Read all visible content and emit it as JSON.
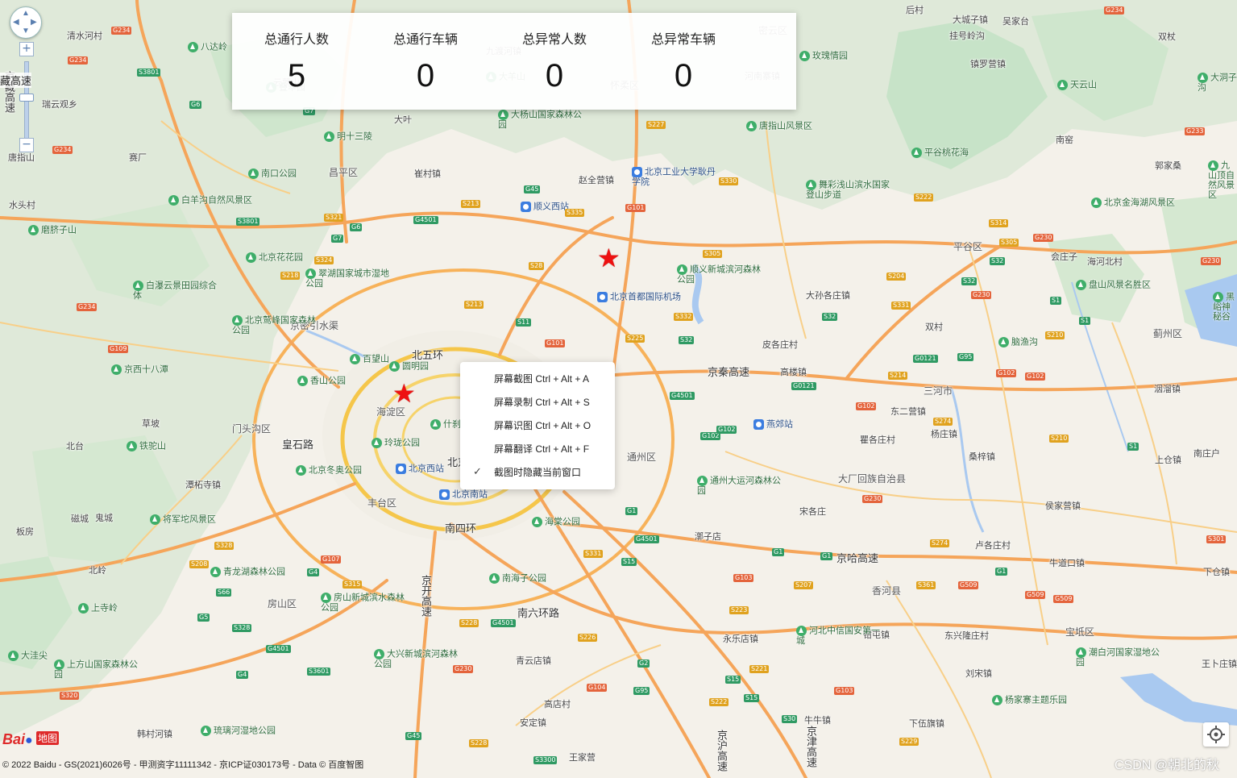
{
  "stats": [
    {
      "title": "总通行人数",
      "value": "5"
    },
    {
      "title": "总通行车辆",
      "value": "0"
    },
    {
      "title": "总异常人数",
      "value": "0"
    },
    {
      "title": "总异常车辆",
      "value": "0"
    }
  ],
  "context_menu": [
    {
      "label": "屏幕截图 Ctrl + Alt + A",
      "checked": false
    },
    {
      "label": "屏幕录制 Ctrl + Alt + S",
      "checked": false
    },
    {
      "label": "屏幕识图 Ctrl + Alt + O",
      "checked": false
    },
    {
      "label": "屏幕翻译 Ctrl + Alt + F",
      "checked": false
    },
    {
      "label": "截图时隐藏当前窗口",
      "checked": true
    }
  ],
  "nav": {
    "zoom_in": "+",
    "zoom_out": "−",
    "side_label": "藏高速"
  },
  "footer": {
    "copyright": "© 2022 Baidu - GS(2021)6026号 - 甲测资字11111342 - 京ICP证030173号 - Data © 百度智图",
    "logo_text": "Bai",
    "logo_map": "地图",
    "watermark": "CSDN @朝北的秋"
  },
  "map_labels": [
    {
      "t": "北五环",
      "c": "road"
    },
    {
      "t": "南四环",
      "c": "road"
    },
    {
      "t": "南六环路",
      "c": "road"
    },
    {
      "t": "京秦高速",
      "c": "road"
    },
    {
      "t": "京哈高速",
      "c": "road"
    },
    {
      "t": "皇石路",
      "c": "road"
    },
    {
      "t": "京开高速",
      "c": "road vert"
    },
    {
      "t": "京沪高速",
      "c": "road vert"
    },
    {
      "t": "京津高速",
      "c": "road vert"
    },
    {
      "t": "京藏高速",
      "c": "road vert"
    },
    {
      "t": "京密引水渠",
      "c": "dist"
    },
    {
      "t": "北京市",
      "c": "big"
    },
    {
      "t": "海淀区",
      "c": "dist"
    },
    {
      "t": "昌平区",
      "c": "dist"
    },
    {
      "t": "门头沟区",
      "c": "dist"
    },
    {
      "t": "丰台区",
      "c": "dist"
    },
    {
      "t": "房山区",
      "c": "dist"
    },
    {
      "t": "通州区",
      "c": "dist"
    },
    {
      "t": "平谷区",
      "c": "dist"
    },
    {
      "t": "三河市",
      "c": "dist"
    },
    {
      "t": "大厂回族自治县",
      "c": "dist"
    },
    {
      "t": "香河县",
      "c": "dist"
    },
    {
      "t": "宝坻区",
      "c": "dist"
    },
    {
      "t": "蓟州区",
      "c": "dist"
    },
    {
      "t": "怀柔区",
      "c": "dist"
    },
    {
      "t": "密云区",
      "c": "dist"
    },
    {
      "t": "清水河村",
      "c": ""
    },
    {
      "t": "瑞云观乡",
      "c": ""
    },
    {
      "t": "唐指山",
      "c": ""
    },
    {
      "t": "赛厂",
      "c": ""
    },
    {
      "t": "崔村镇",
      "c": ""
    },
    {
      "t": "赵全营镇",
      "c": ""
    },
    {
      "t": "南窑",
      "c": ""
    },
    {
      "t": "大孙各庄镇",
      "c": ""
    },
    {
      "t": "皮各庄村",
      "c": ""
    },
    {
      "t": "高楼镇",
      "c": ""
    },
    {
      "t": "双村",
      "c": ""
    },
    {
      "t": "东二营镇",
      "c": ""
    },
    {
      "t": "杨庄镇",
      "c": ""
    },
    {
      "t": "桑梓镇",
      "c": ""
    },
    {
      "t": "侯家营镇",
      "c": ""
    },
    {
      "t": "上仓镇",
      "c": ""
    },
    {
      "t": "南庄户",
      "c": ""
    },
    {
      "t": "洇溜镇",
      "c": ""
    },
    {
      "t": "瞿各庄村",
      "c": ""
    },
    {
      "t": "宋各庄",
      "c": ""
    },
    {
      "t": "漷子店",
      "c": ""
    },
    {
      "t": "永乐店镇",
      "c": ""
    },
    {
      "t": "牛道口镇",
      "c": ""
    },
    {
      "t": "卢各庄村",
      "c": ""
    },
    {
      "t": "钳屯镇",
      "c": ""
    },
    {
      "t": "东兴隆庄村",
      "c": ""
    },
    {
      "t": "刘宋镇",
      "c": ""
    },
    {
      "t": "下伍旗镇",
      "c": ""
    },
    {
      "t": "牛牛镇",
      "c": ""
    },
    {
      "t": "青云店镇",
      "c": ""
    },
    {
      "t": "高店村",
      "c": ""
    },
    {
      "t": "安定镇",
      "c": ""
    },
    {
      "t": "王家营",
      "c": ""
    },
    {
      "t": "韩村河镇",
      "c": ""
    },
    {
      "t": "北台",
      "c": ""
    },
    {
      "t": "鬼城",
      "c": ""
    },
    {
      "t": "磁城",
      "c": ""
    },
    {
      "t": "北岭",
      "c": ""
    },
    {
      "t": "板房",
      "c": ""
    },
    {
      "t": "潭柘寺镇",
      "c": ""
    },
    {
      "t": "草坡",
      "c": ""
    },
    {
      "t": "水头村",
      "c": ""
    },
    {
      "t": "会庄子",
      "c": ""
    },
    {
      "t": "海河北村",
      "c": ""
    },
    {
      "t": "郭家桑",
      "c": ""
    },
    {
      "t": "镇罗营镇",
      "c": ""
    },
    {
      "t": "挂号岭沟",
      "c": ""
    },
    {
      "t": "后村",
      "c": ""
    },
    {
      "t": "大城子镇",
      "c": ""
    },
    {
      "t": "吴家台",
      "c": ""
    },
    {
      "t": "双杖",
      "c": ""
    },
    {
      "t": "王卜庄镇",
      "c": ""
    },
    {
      "t": "下仓镇",
      "c": ""
    },
    {
      "t": "九渡河镇",
      "c": ""
    },
    {
      "t": "河南寨镇",
      "c": ""
    },
    {
      "t": "大叶",
      "c": ""
    },
    {
      "t": "云蒙山",
      "c": ""
    }
  ],
  "pois": [
    {
      "t": "八达岭",
      "k": "g"
    },
    {
      "t": "明十三陵",
      "k": "g"
    },
    {
      "t": "南口公园",
      "k": "g"
    },
    {
      "t": "白羊沟自然风景区",
      "k": "g"
    },
    {
      "t": "磨脐子山",
      "k": "g"
    },
    {
      "t": "北京花花园",
      "k": "g"
    },
    {
      "t": "翠湖国家城市湿地公园",
      "k": "g"
    },
    {
      "t": "白瀑云景田园综合体",
      "k": "g"
    },
    {
      "t": "北京鹫峰国家森林公园",
      "k": "g"
    },
    {
      "t": "百望山",
      "k": "g"
    },
    {
      "t": "圆明园",
      "k": "g"
    },
    {
      "t": "京西十八潭",
      "k": "g"
    },
    {
      "t": "香山公园",
      "k": "g"
    },
    {
      "t": "玲珑公园",
      "k": "g"
    },
    {
      "t": "什刹海公园",
      "k": "g"
    },
    {
      "t": "铁驼山",
      "k": "g"
    },
    {
      "t": "北京冬奥公园",
      "k": "g"
    },
    {
      "t": "将军坨风景区",
      "k": "g"
    },
    {
      "t": "青龙湖森林公园",
      "k": "g"
    },
    {
      "t": "房山新城滨水森林公园",
      "k": "g"
    },
    {
      "t": "上寺岭",
      "k": "g"
    },
    {
      "t": "大洼尖",
      "k": "g"
    },
    {
      "t": "上方山国家森林公园",
      "k": "g"
    },
    {
      "t": "大兴新城滨河森林公园",
      "k": "g"
    },
    {
      "t": "琉璃河湿地公园",
      "k": "g"
    },
    {
      "t": "南海子公园",
      "k": "g"
    },
    {
      "t": "海棠公园",
      "k": "g"
    },
    {
      "t": "通州大运河森林公园",
      "k": "g"
    },
    {
      "t": "顺义新城滨河森林公园",
      "k": "g"
    },
    {
      "t": "舞彩浅山滨水国家登山步道",
      "k": "g"
    },
    {
      "t": "唐指山风景区",
      "k": "g"
    },
    {
      "t": "平谷桃花海",
      "k": "g"
    },
    {
      "t": "玫瑰情园",
      "k": "g"
    },
    {
      "t": "天云山",
      "k": "g"
    },
    {
      "t": "大洞子沟",
      "k": "g"
    },
    {
      "t": "九山顶自然风景区",
      "k": "g"
    },
    {
      "t": "北京金海湖风景区",
      "k": "g"
    },
    {
      "t": "盘山风景名胜区",
      "k": "g"
    },
    {
      "t": "黑峪神秘谷",
      "k": "g"
    },
    {
      "t": "脑渔沟",
      "k": "g"
    },
    {
      "t": "河北中信国安第一城",
      "k": "g"
    },
    {
      "t": "潮白河国家湿地公园",
      "k": "g"
    },
    {
      "t": "杨家寨主题乐园",
      "k": "g"
    },
    {
      "t": "大杨山国家森林公园",
      "k": "g"
    },
    {
      "t": "大羊山",
      "k": "g"
    },
    {
      "t": "叠翠园",
      "k": "g"
    },
    {
      "t": "顺义西站",
      "k": "b"
    },
    {
      "t": "北京首都国际机场",
      "k": "b"
    },
    {
      "t": "北京工业大学耿丹学院",
      "k": "b"
    },
    {
      "t": "北京西站",
      "k": "b"
    },
    {
      "t": "北京南站",
      "k": "b"
    },
    {
      "t": "燕郊站",
      "k": "b"
    }
  ]
}
